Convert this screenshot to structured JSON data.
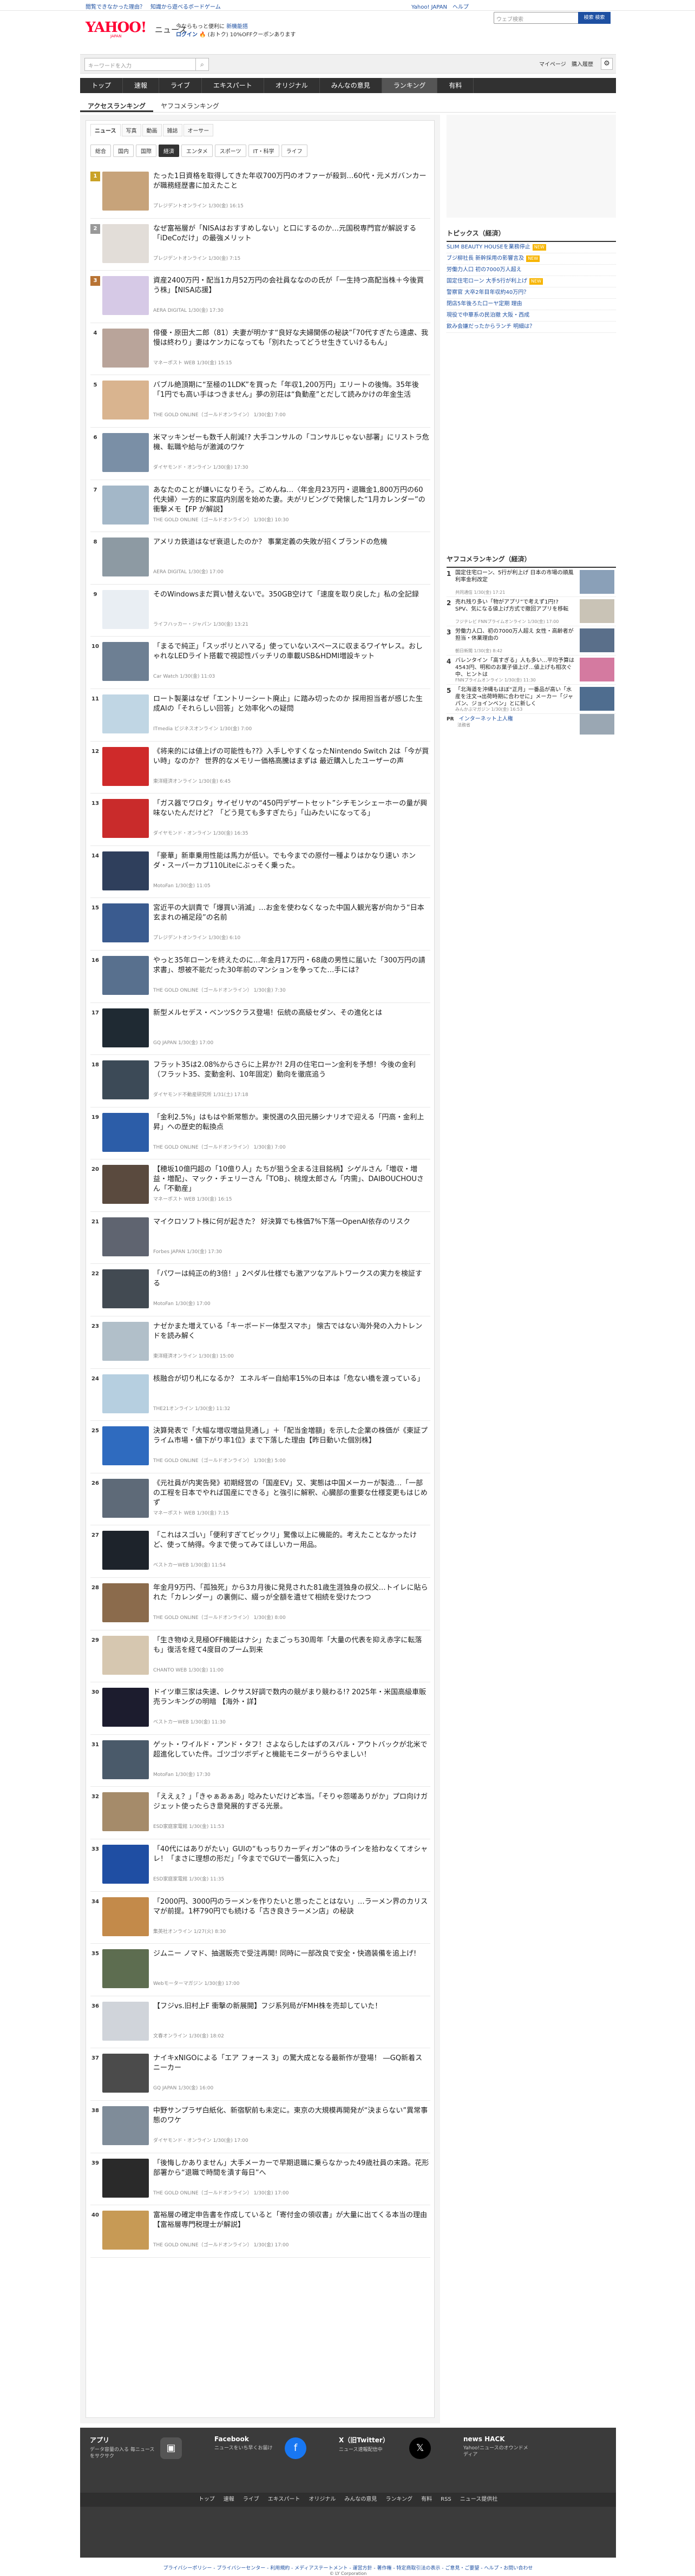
{
  "topstrip": {
    "left": "閲覧できなかった理由？　知識から遊べるボードゲーム",
    "right": "Yahoo! JAPAN　ヘルプ"
  },
  "header": {
    "logo_text": "YAHOO!",
    "logo_sub": "JAPAN",
    "section": "ニュース",
    "promo_line1": "今ならもっと便利に",
    "promo_link": "新機能搭",
    "promo_line2_login": "ログイン",
    "promo_line2_rest": " 🔥 (おトク) 10%OFFクーポンあります",
    "search_placeholder": "ウェブ検索",
    "search_btn": "検索 検索"
  },
  "searchbar": {
    "placeholder": "キーワードを入力",
    "mypage": "マイページ",
    "purchase": "購入履歴"
  },
  "nav": [
    "トップ",
    "速報",
    "ライブ",
    "エキスパート",
    "オリジナル",
    "みんなの意見",
    "ランキング",
    "有料"
  ],
  "nav_active": 6,
  "ranking_tabs": [
    "アクセスランキング",
    "ヤフコメランキング"
  ],
  "sub_tabs": [
    "ニュース",
    "写真",
    "動画",
    "雑誌",
    "オーサー"
  ],
  "categories": [
    "総合",
    "国内",
    "国際",
    "経済",
    "エンタメ",
    "スポーツ",
    "IT・科学",
    "ライフ"
  ],
  "items": [
    {
      "rank": "1",
      "title": "たった1日資格を取得してきた年収700万円のオファーが殺到…60代・元メガバンカーが職務経歴書に加えたこと",
      "src": "プレジデントオンライン 1/30(金) 16:15"
    },
    {
      "rank": "2",
      "title": "なぜ富裕層が「NISAはおすすめしない」と口にするのか…元国税専門官が解説する「iDeCoだけ」の最強メリット",
      "src": "プレジデントオンライン 1/30(金) 7:15"
    },
    {
      "rank": "3",
      "title": "資産2400万円・配当1カ月52万円の会社員ななのの氏が「一生持つ高配当株＋今後買う株」【NISA応援】",
      "src": "AERA DIGITAL 1/30(金) 17:30"
    },
    {
      "rank": "4",
      "title": "俳優・原田大二郎（81）夫妻が明かす“良好な夫婦関係の秘訣”「70代すぎたら遠慮、我慢は終わり」妻はケンカになっても「別れたってどうせ生きていけるもん」",
      "src": "マネーポスト WEB 1/30(金) 15:15"
    },
    {
      "rank": "5",
      "title": "バブル絶頂期に“至極の1LDK”を買った「年収1,200万円」エリートの後悔。35年後「1円でも高い手はつきません」夢の別荘は“負動産”とだして読みかけの年金生活",
      "src": "THE GOLD ONLINE（ゴールドオンライン） 1/30(金) 7:00"
    },
    {
      "rank": "6",
      "title": "米マッキンゼーも数千人削減!? 大手コンサルの「コンサルじゃない部署」にリストラ危機、転職や給与が激減のワケ",
      "src": "ダイヤモンド・オンライン 1/30(金) 17:30"
    },
    {
      "rank": "7",
      "title": "あなたのことが嫌いになりそう。ごめんね…〈年金月23万円・退職金1,800万円の60代夫婦〉一方的に家庭内別居を始めた妻。夫がリビングで発懐した“1月カレンダー”の衝撃メモ【FP が解説】",
      "src": "THE GOLD ONLINE（ゴールドオンライン） 1/30(金) 10:30"
    },
    {
      "rank": "8",
      "title": "アメリカ鉄道はなぜ衰退したのか？ 事業定義の失敗が招くブランドの危機",
      "src": "AERA DIGITAL 1/30(金) 17:00"
    },
    {
      "rank": "9",
      "title": "そのWindowsまだ買い替えないで。350GB空けて「速度を取り戻した」私の全記録",
      "src": "ライフハッカー・ジャパン 1/30(金) 13:21"
    },
    {
      "rank": "10",
      "title": "「まるで純正」「スッポリとハマる」使っていないスペースに収まるワイヤレス。おしゃれなLEDライト搭載で視認性バッチリの車載USB&HDMI増設キット",
      "src": "Car Watch 1/30(金) 11:03"
    },
    {
      "rank": "11",
      "title": "ロート製薬はなぜ「エントリーシート廃止」に踏み切ったのか 採用担当者が感じた生成AIの「それらしい回答」と効率化への疑問",
      "src": "ITmedia ビジネスオンライン 1/30(金) 7:00"
    },
    {
      "rank": "12",
      "title": "《将来的には値上げの可能性も??》入手しやすくなったNintendo Switch 2は「今が買い時」なのか？ 世界的なメモリー価格高騰はまずは 最近購入したユーザーの声",
      "src": "東洋経済オンライン 1/30(金) 6:45"
    },
    {
      "rank": "13",
      "title": "「ガス器でワロタ」サイゼリヤの“450円デザートセット”シチモンシェーホーの量が興味ないたんだけど？「どう見ても多すぎたら」「山みたいになってる」",
      "src": "ダイヤモンド・オンライン 1/30(金) 16:35"
    },
    {
      "rank": "14",
      "title": "「豪華」新車乗用性能は馬力が低い。でも今までの原付一種よりはかなり速い ホンダ・スーパーカブ110Liteにぶっそく乗った。",
      "src": "MotoFan 1/30(金) 11:05"
    },
    {
      "rank": "15",
      "title": "宮近平の大訓責で「爆買い消滅」…お金を使わなくなった中国人観光客が向かう“日本玄まれの補足段”の名前",
      "src": "プレジデントオンライン 1/30(金) 6:10"
    },
    {
      "rank": "16",
      "title": "やっと35年ローンを終えたのに…年金月17万円・68歳の男性に届いた「300万円の請求書」、想被不能だった30年前のマンションを争ってた…手には？",
      "src": "THE GOLD ONLINE（ゴールドオンライン） 1/30(金) 7:30"
    },
    {
      "rank": "17",
      "title": "新型メルセデス・ベンツSクラス登場！伝統の高級セダン、その進化とは",
      "src": "GQ JAPAN 1/30(金) 17:00"
    },
    {
      "rank": "18",
      "title": "フラット35は2.08%からさらに上昇か?! 2月の住宅ローン金利を予想！今後の金利（フラット35、変動金利、10年固定）動向を徹底追う",
      "src": "ダイヤモンド不動産研究所 1/31(土) 17:18"
    },
    {
      "rank": "19",
      "title": "「金利2.5%」はもはや新常態か。東悦選の久田元勝シナリオで迎える「円高・金利上昇」への歴史的転換点",
      "src": "THE GOLD ONLINE（ゴールドオンライン） 1/30(金) 7:00"
    },
    {
      "rank": "20",
      "title": "【穂坂10億円超の「10億り人」たちが狙う全まる注目銘柄】シゲルさん「増収・増益・増配」、マック・チェリーさん「TOB」、桃煌太郎さん「内需」、DAIBOUCHOUさん「不動産」",
      "src": "マネーポスト WEB 1/30(金) 16:15"
    },
    {
      "rank": "21",
      "title": "マイクロソフト株に何が起きた？ 好決算でも株価7%下落一OpenAI依存のリスク",
      "src": "Forbes JAPAN 1/30(金) 17:30"
    },
    {
      "rank": "22",
      "title": "「パワーは純正の約3倍！」2ペダル仕様でも激アツなアルトワークスの実力を検証する",
      "src": "MotoFan 1/30(金) 17:00"
    },
    {
      "rank": "23",
      "title": "ナゼかまた増えている「キーボード一体型スマホ」 懐古ではない海外発の入力トレンドを読み解く",
      "src": "東洋経済オンライン 1/30(金) 15:00"
    },
    {
      "rank": "24",
      "title": "核融合が切り札になるか？ エネルギー自給率15%の日本は「危ない橋を渡っている」",
      "src": "THE21オンライン 1/30(金) 11:32"
    },
    {
      "rank": "25",
      "title": "決算発表で「大幅な増収増益見通し」＋「配当金増額」を示した企業の株価が《東証プライム市場・値下がり率1位》まで下落した理由【昨日動いた個別株】",
      "src": "THE GOLD ONLINE（ゴールドオンライン） 1/30(金) 5:00"
    },
    {
      "rank": "26",
      "title": "《元社員が内実告発》初期経営の「国産EV」又、実態は中国メーカーが製造…「一部の工程を日本でやれば国産にできる」と強引に解釈、心臓部の重要な仕様変更もはじめず",
      "src": "マネーポスト WEB 1/30(金) 7:15"
    },
    {
      "rank": "27",
      "title": "「これはスゴい」「便利すぎてビックリ」驚像以上に機能的。考えたことなかったけど、使って納得。今まで使ってみてほしいカー用品。",
      "src": "ベストカーWEB 1/30(金) 11:54"
    },
    {
      "rank": "28",
      "title": "年金月9万円、「孤独死」から3カ月後に発見された81歳生涯独身の叔父…トイレに貼られた「カレンダー」の裏側に、綴っが全額を遺せて相続を受けたつつ",
      "src": "THE GOLD ONLINE（ゴールドオンライン） 1/30(金) 8:00"
    },
    {
      "rank": "29",
      "title": "「生き物ゆえ見極OFF機能はナシ」たまごっち30周年「大量の代表を抑え赤字に転落も」復活を経て4度目のブーム到来",
      "src": "CHANTO WEB 1/30(金) 11:00"
    },
    {
      "rank": "30",
      "title": "ドイツ車三家は失速、レクサス好調で数内の競がまり競わる!? 2025年・米国高級車販売ランキングの明暗 【海外・詳】",
      "src": "ベストカーWEB 1/30(金) 11:30"
    },
    {
      "rank": "31",
      "title": "ゲット・ワイルド・アンド・タフ！さよならしたはずのスバル・アウトバックが北米で超進化していた件。ゴツゴツボディと機能モニターがうらやましい！",
      "src": "MotoFan 1/30(金) 17:30"
    },
    {
      "rank": "32",
      "title": "「ええぇ？」「きゃぁあぁあ」唸みたいだけど本当。「そりゃ怨嗟ありがか」プロ向けガジェット使ったらき意発展的すぎる光景。",
      "src": "ESD家庭家電館 1/30(金) 11:53"
    },
    {
      "rank": "33",
      "title": "「40代にはありがたい」GUIの“もっちりカーディガン”体のラインを拾わなくてオシャレ！「まさに理想の形だ」「今まででGUで一番気に入った」",
      "src": "ESD家庭家電館 1/30(金) 11:35"
    },
    {
      "rank": "34",
      "title": "「2000円、3000円のラーメンを作りたいと思ったことはない」…ラーメン界のカリスマが前提。1杯790円でも続ける「古き良きラーメン店」の秘訣",
      "src": "集英社オンライン 1/27(火) 8:30"
    },
    {
      "rank": "35",
      "title": "ジムニー ノマド、抽選販売で受注再開! 同時に一部改良で安全・快適装備を追上げ!",
      "src": "Webモーターマガジン 1/30(金) 17:00"
    },
    {
      "rank": "36",
      "title": "【フジvs.旧村上F 衝撃の新展開】フジ系列局がFMH株を売却していた！",
      "src": "文春オンライン 1/30(金) 18:02"
    },
    {
      "rank": "37",
      "title": "ナイキxNIGOによる「エア フォース 3」の驚大成となる最新作が登場！ ―GQ新着スニーカー",
      "src": "GQ JAPAN 1/30(金) 16:00"
    },
    {
      "rank": "38",
      "title": "中野サンプラザ白紙化、新宿駅前も未定に。東京の大規模再開発が“決まらない”異常事態のワケ",
      "src": "ダイヤモンド・オンライン 1/30(金) 17:00"
    },
    {
      "rank": "39",
      "title": "「後悔しかありません」大手メーカーで早期退職に乗らなかった49歳社員の末路。花形部署から“退職で時間を潰す毎日”へ",
      "src": "THE GOLD ONLINE（ゴールドオンライン） 1/30(金) 17:00"
    },
    {
      "rank": "40",
      "title": "富裕層の確定申告書を作成していると「寄付金の領収書」が大量に出てくる本当の理由【富裕層専門税理士が解説】",
      "src": "THE GOLD ONLINE（ゴールドオンライン） 1/30(金) 17:00"
    }
  ],
  "topics": {
    "heading": "トピックス（経済）",
    "items": [
      {
        "text": "SLIM BEAUTY HOUSEを業務停止",
        "new": "NEW"
      },
      {
        "text": "ブジ柳社長 新幹採用の影響言及",
        "new": "NEW"
      },
      {
        "text": "労働力人口 初の7000万人超え"
      },
      {
        "text": "国定住宅ローン 大手5行が利上げ",
        "new": "NEW"
      },
      {
        "text": "警察官 大卒2年目年収約40万円？"
      },
      {
        "text": "閉店5年後ろた口ーヤ定期 理由"
      },
      {
        "text": "現役で中華系の民泊撤 大阪・西成"
      },
      {
        "text": "飲み会嫌だったからランチ 明細は？"
      }
    ]
  },
  "yahoo_comment": {
    "heading": "ヤフコメランキング（経済）",
    "items": [
      {
        "n": "1",
        "t": "国定住宅ローン、5行が利上げ 日本の市場の順風利率金利改定",
        "s": "共同通信 1/30(金) 17:21"
      },
      {
        "n": "2",
        "t": "売れ残り多い「物がアプリ”で考えず1円!? SPV、気になる値上げ方式で撤回アプリを移転",
        "s": "フジテレビ FNNプライムオンライン 1/30(金) 17:00"
      },
      {
        "n": "3",
        "t": "労働力人口、初の7000万人超え 女性・高齢者が担当・休業理由の",
        "s": "朝日新聞 1/30(金) 8:42"
      },
      {
        "n": "4",
        "t": "バレンタイン「高すぎる」人も多い…平均予算は4543円、明和のお菓子値上げ…値上げも相次ぐ中、ヒントは",
        "s": "FNNプライムオンライン 1/30(金) 11:30"
      },
      {
        "n": "5",
        "t": "「北海道を沖縄もほぼ“正月」一番品が高い「水産を注文→出荷時期に合わせに」メーカー「ジャパン、ジョインベン」とに新しく",
        "s": "みんかぶマガジン 1/30(金) 16:53"
      }
    ],
    "pr_label": "PR",
    "pr_text": "インターネット上人権",
    "pr_sub": "法務省"
  },
  "footer": {
    "cols": [
      {
        "title": "アプリ",
        "desc": "データ容量の入る 毎ニュースをサクサク"
      },
      {
        "title": "Facebook",
        "desc": "ニュースをいち早くお届け"
      },
      {
        "title": "X（旧Twitter）",
        "desc": "ニュース速報配信中"
      },
      {
        "title": "news HACK",
        "desc": "Yahoo!ニュースのオウンドメディア"
      }
    ],
    "links": [
      "トップ",
      "速報",
      "ライブ",
      "エキスパート",
      "オリジナル",
      "みんなの意見",
      "ランキング",
      "有料",
      "RSS",
      "ニュース提供社"
    ],
    "legal": "プライバシーポリシー - プライバシーセンター - 利用規約 - メディアステートメント - 運営方針 - 著作権 - 特定商取引法の表示 - ご意見・ご要望 - ヘルプ・お問い合わせ",
    "copyright": "© LY Corporation"
  },
  "thumb_colors": [
    "#c7a37a",
    "#e2ddd8",
    "#d6c9e6",
    "#b9a49a",
    "#d9b48f",
    "#7a8fa6",
    "#a3b7c8",
    "#8d9aa3",
    "#e9eef3",
    "#6d7f93",
    "#c0d6e4",
    "#cf2a2a",
    "#c92b2b",
    "#2f3f5c",
    "#3a5b8f",
    "#58708e",
    "#1f2a33",
    "#3c4a57",
    "#2c5da8",
    "#5a4a3e",
    "#5f6470",
    "#424a52",
    "#b1bfc9",
    "#b6cfe0",
    "#2f6bbf",
    "#5e6a78",
    "#1d232b",
    "#8b6b4c",
    "#d6c7b0",
    "#1c1c2e",
    "#4a5a6a",
    "#a58b6a",
    "#1f4ea3",
    "#c38a4a",
    "#5d6d50",
    "#d0d4da",
    "#4b4b4b",
    "#7f8c99",
    "#2a2a2a",
    "#c79a55"
  ]
}
